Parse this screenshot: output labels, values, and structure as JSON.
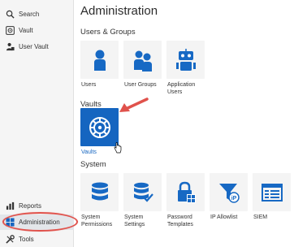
{
  "sidebar": {
    "items": [
      {
        "label": "Search",
        "icon": "search-icon"
      },
      {
        "label": "Vault",
        "icon": "vault-icon"
      },
      {
        "label": "User Vault",
        "icon": "user-vault-icon"
      },
      {
        "label": "Reports",
        "icon": "reports-icon"
      },
      {
        "label": "Administration",
        "icon": "administration-icon",
        "active": true
      },
      {
        "label": "Tools",
        "icon": "tools-icon"
      }
    ]
  },
  "main": {
    "title": "Administration",
    "sections": {
      "users_groups": {
        "title": "Users & Groups",
        "tiles": [
          {
            "label": "Users",
            "icon": "user-icon"
          },
          {
            "label": "User Groups",
            "icon": "user-groups-icon"
          },
          {
            "label": "Application Users",
            "icon": "robot-icon"
          }
        ]
      },
      "vaults": {
        "title": "Vaults",
        "tiles": [
          {
            "label": "Vaults",
            "icon": "vault-dial-icon",
            "selected": true
          }
        ]
      },
      "system": {
        "title": "System",
        "tiles": [
          {
            "label": "System Permissions",
            "icon": "database-icon"
          },
          {
            "label": "System Settings",
            "icon": "database-check-icon"
          },
          {
            "label": "Password Templates",
            "icon": "lock-grid-icon"
          },
          {
            "label": "IP Allowlist",
            "icon": "funnel-ip-icon"
          },
          {
            "label": "SIEM",
            "icon": "siem-window-icon"
          }
        ]
      }
    }
  },
  "colors": {
    "accent": "#1565c0",
    "icon_blue": "#1769c4",
    "highlight_red": "#e0524c"
  }
}
